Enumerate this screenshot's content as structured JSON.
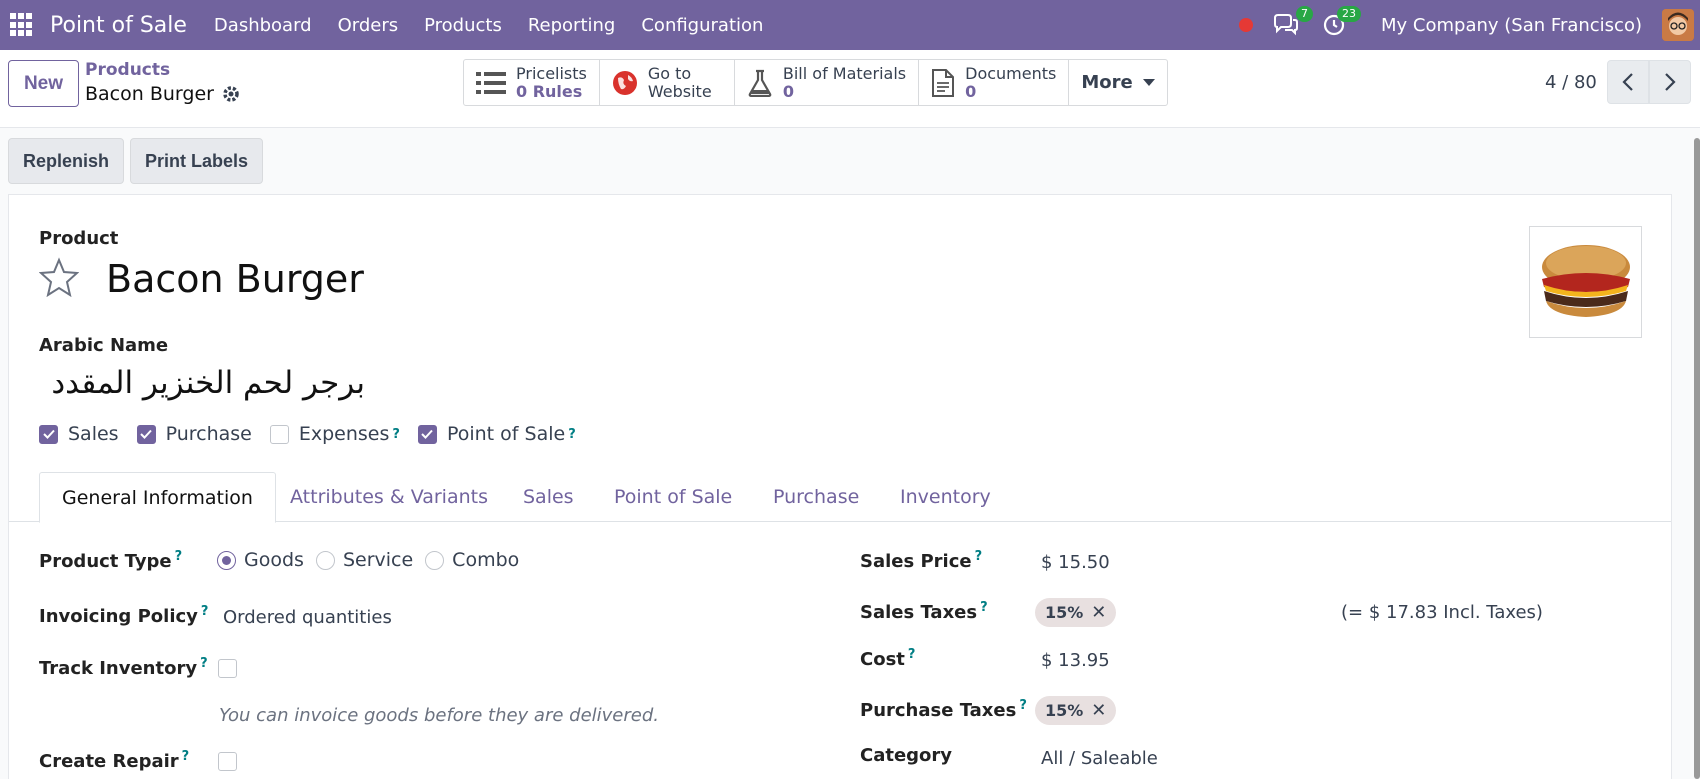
{
  "topnav": {
    "brand": "Point of Sale",
    "menu": [
      "Dashboard",
      "Orders",
      "Products",
      "Reporting",
      "Configuration"
    ],
    "chat_count": "7",
    "activity_count": "23",
    "company": "My Company (San Francisco)"
  },
  "control": {
    "new_label": "New",
    "breadcrumb_parent": "Products",
    "breadcrumb_current": "Bacon Burger",
    "smart_buttons": [
      {
        "line1": "Pricelists",
        "line2": "0 Rules"
      },
      {
        "line1": "Go to",
        "line2": "Website"
      },
      {
        "line1": "Bill of Materials",
        "line2": "0"
      },
      {
        "line1": "Documents",
        "line2": "0"
      }
    ],
    "more_label": "More",
    "pager": "4 / 80"
  },
  "statusbar": {
    "replenish": "Replenish",
    "print_labels": "Print Labels"
  },
  "form": {
    "product_label": "Product",
    "product_name": "Bacon Burger",
    "arabic_label": "Arabic Name",
    "arabic_value": "برجر لحم الخنزير المقدد",
    "checkboxes": [
      {
        "label": "Sales",
        "checked": true,
        "help": false
      },
      {
        "label": "Purchase",
        "checked": true,
        "help": false
      },
      {
        "label": "Expenses",
        "checked": false,
        "help": true
      },
      {
        "label": "Point of Sale",
        "checked": true,
        "help": true
      }
    ],
    "help_mark": "?"
  },
  "tabs": [
    "General Information",
    "Attributes & Variants",
    "Sales",
    "Point of Sale",
    "Purchase",
    "Inventory"
  ],
  "general": {
    "product_type_label": "Product Type",
    "product_type_options": [
      "Goods",
      "Service",
      "Combo"
    ],
    "product_type_selected": "Goods",
    "invoicing_label": "Invoicing Policy",
    "invoicing_value": "Ordered quantities",
    "track_inventory_label": "Track Inventory",
    "track_inventory_hint": "You can invoice goods before they are delivered.",
    "create_repair_label": "Create Repair",
    "sales_price_label": "Sales Price",
    "sales_price_value": "$ 15.50",
    "sales_taxes_label": "Sales Taxes",
    "sales_taxes_tag": "15%",
    "sales_taxes_incl": "(= $ 17.83 Incl. Taxes)",
    "cost_label": "Cost",
    "cost_value": "$ 13.95",
    "purchase_taxes_label": "Purchase Taxes",
    "purchase_taxes_tag": "15%",
    "category_label": "Category",
    "category_value": "All / Saleable"
  },
  "colors": {
    "brand": "#71639e",
    "help": "#017e84"
  }
}
